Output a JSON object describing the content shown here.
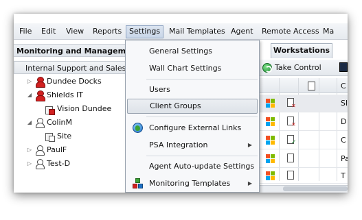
{
  "menubar": {
    "items": [
      "File",
      "Edit",
      "View",
      "Reports",
      "Settings",
      "Mail Templates",
      "Agent",
      "Remote Access",
      "Ma"
    ],
    "active": "Settings"
  },
  "left_panel": {
    "header": "Monitoring and Management",
    "subheader": "Internal Support and Sales Ac",
    "tree": [
      {
        "label": "Dundee Docks",
        "icon": "client-red-icon",
        "expand": "collapsed"
      },
      {
        "label": "Shields IT",
        "icon": "client-red-icon",
        "expand": "expanded"
      },
      {
        "label": "Vision Dundee",
        "icon": "site-alert-icon",
        "expand": "none"
      },
      {
        "label": "ColinM",
        "icon": "client-icon",
        "expand": "expanded"
      },
      {
        "label": "Site",
        "icon": "site-icon",
        "expand": "none"
      },
      {
        "label": "PaulF",
        "icon": "client-icon",
        "expand": "collapsed"
      },
      {
        "label": "Test-D",
        "icon": "client-icon",
        "expand": "collapsed"
      }
    ]
  },
  "right_panel": {
    "tab": "Workstations",
    "toolbar": {
      "take_control": "Take Control"
    },
    "grid_header_fragment": "C",
    "rows": [
      {
        "os": "windows-icon",
        "status": "device-failed-icon",
        "name_fragment": "Sl",
        "selected": true
      },
      {
        "os": "windows-icon",
        "status": "device-failed-icon",
        "name_fragment": "D",
        "selected": false
      },
      {
        "os": "windows-icon",
        "status": "device-ok-icon",
        "name_fragment": "C",
        "selected": false
      },
      {
        "os": "windows-icon",
        "status": "device-icon",
        "name_fragment": "Pa",
        "selected": false
      },
      {
        "os": "windows-icon",
        "status": "device-icon",
        "name_fragment": "T",
        "selected": false
      }
    ]
  },
  "settings_menu": {
    "general_settings": "General Settings",
    "wall_chart_settings": "Wall Chart Settings",
    "users": "Users",
    "client_groups": "Client Groups",
    "configure_external_links": "Configure External Links",
    "psa_integration": "PSA Integration",
    "agent_autoupdate_settings": "Agent Auto-update Settings",
    "monitoring_templates": "Monitoring Templates",
    "hovered": "Client Groups"
  }
}
